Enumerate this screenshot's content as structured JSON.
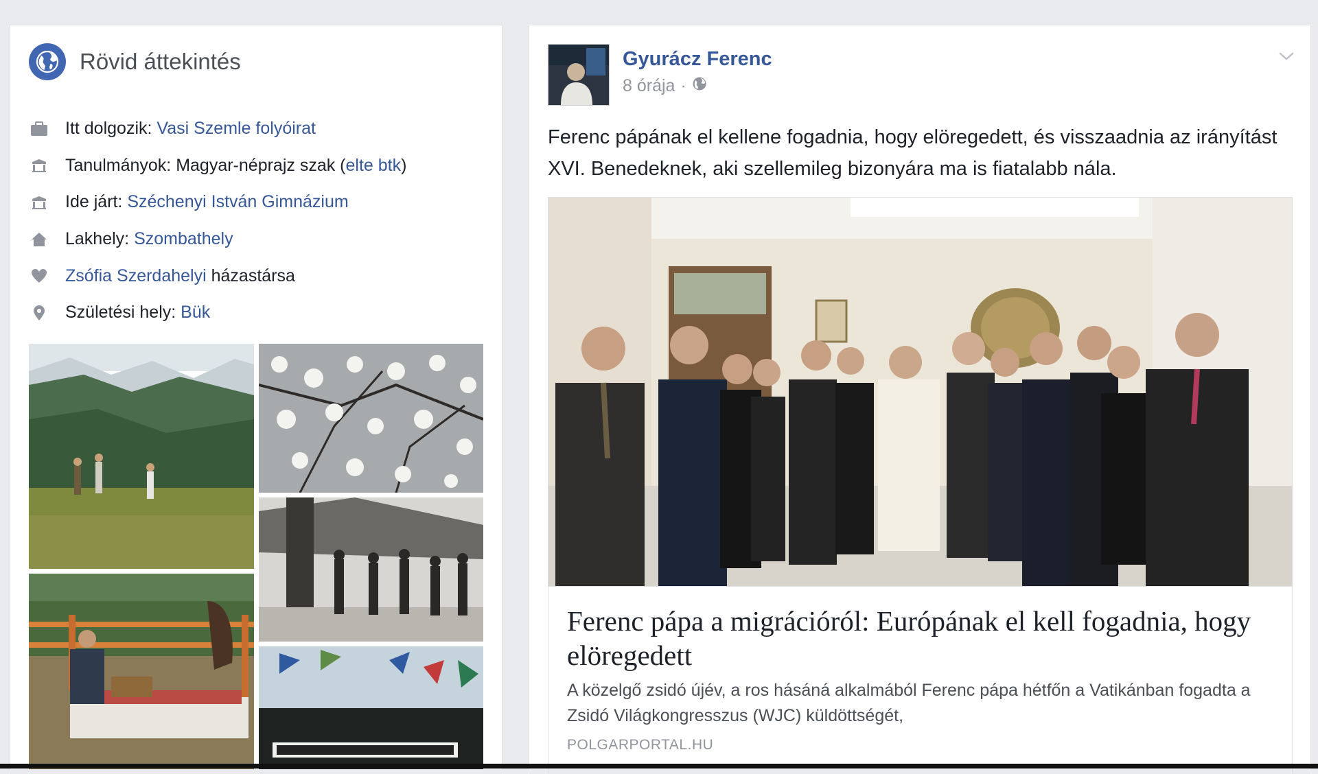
{
  "intro": {
    "title": "Rövid áttekintés",
    "items": [
      {
        "icon": "briefcase-icon",
        "prefix": "Itt dolgozik: ",
        "link": "Vasi Szemle folyóirat",
        "mid": "",
        "link2": "",
        "suffix": ""
      },
      {
        "icon": "graduation-cap-icon",
        "prefix": "Tanulmányok: Magyar-néprajz szak (",
        "link": "elte btk",
        "mid": "",
        "link2": "",
        "suffix": ")"
      },
      {
        "icon": "graduation-cap-icon",
        "prefix": "Ide járt: ",
        "link": "Széchenyi István Gimnázium",
        "mid": "",
        "link2": "",
        "suffix": ""
      },
      {
        "icon": "home-icon",
        "prefix": "Lakhely: ",
        "link": "Szombathely",
        "mid": "",
        "link2": "",
        "suffix": ""
      },
      {
        "icon": "heart-icon",
        "prefix": "",
        "link": "Zsófia Szerdahelyi",
        "mid": "",
        "link2": "",
        "suffix": " házastársa"
      },
      {
        "icon": "map-pin-icon",
        "prefix": "Születési hely: ",
        "link": "Bük",
        "mid": "",
        "link2": "",
        "suffix": ""
      }
    ]
  },
  "post": {
    "author": "Gyurácz Ferenc",
    "time": "8 órája",
    "separator": "·",
    "privacy_icon": "globe-icon",
    "text": "Ferenc pápának el kellene fogadnia, hogy elöregedett, és visszaadnia az irányítást XVI. Benedeknek, aki szellemileg bizonyára ma is fiatalabb nála.",
    "link": {
      "title": "Ferenc pápa a migrációról: Európának el kell fogadnia, hogy elöregedett",
      "description": "A közelgő zsidó újév, a ros hásáná alkalmából Ferenc pápa hétfőn a Vatikánban fogadta a Zsidó Világkongresszus (WJC) küldöttségét,",
      "domain": "POLGARPORTAL.HU"
    }
  },
  "colors": {
    "link": "#365899",
    "accent": "#4267b2",
    "muted": "#90949c",
    "background": "#e9ebee"
  }
}
